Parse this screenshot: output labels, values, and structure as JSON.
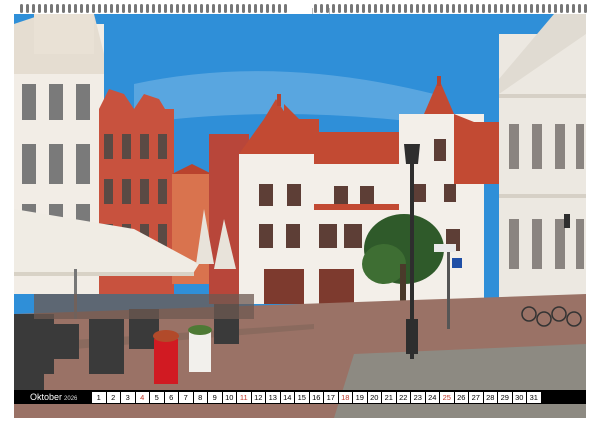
{
  "calendar": {
    "month": "Oktober",
    "year": "2026",
    "days": [
      "1",
      "2",
      "3",
      "4",
      "5",
      "6",
      "7",
      "8",
      "9",
      "10",
      "11",
      "12",
      "13",
      "14",
      "15",
      "16",
      "17",
      "18",
      "19",
      "20",
      "21",
      "22",
      "23",
      "24",
      "25",
      "26",
      "27",
      "28",
      "29",
      "30",
      "31"
    ],
    "sundays": [
      4,
      11,
      18,
      25
    ]
  },
  "photo": {
    "sky_color": "#2f8fd8",
    "facade_white": "#f2ede6",
    "facade_red": "#c8523e",
    "roof_red": "#c24a33",
    "pavement": "#9a7266",
    "umbrella_color": "#f0ece4",
    "planter_red": "#d11a22"
  }
}
